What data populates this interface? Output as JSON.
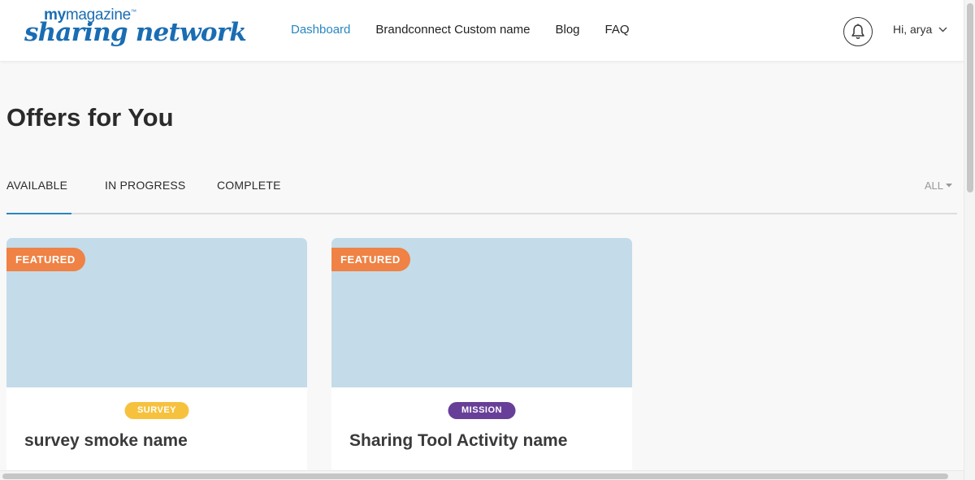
{
  "header": {
    "logo": {
      "top_bold": "my",
      "top_rest": "magazine",
      "top_mark": "™",
      "script": "sharing network"
    },
    "nav": [
      {
        "label": "Dashboard",
        "active": true
      },
      {
        "label": "Brandconnect Custom name",
        "active": false
      },
      {
        "label": "Blog",
        "active": false
      },
      {
        "label": "FAQ",
        "active": false
      }
    ],
    "notification_icon": "bell-icon",
    "user_greeting": "Hi, arya",
    "user_menu_icon": "chevron-down-icon"
  },
  "page": {
    "title": "Offers for You"
  },
  "tabs": {
    "items": [
      {
        "label": "AVAILABLE",
        "active": true
      },
      {
        "label": "IN PROGRESS",
        "active": false
      },
      {
        "label": "COMPLETE",
        "active": false
      }
    ],
    "filter": {
      "label": "ALL",
      "icon": "caret-down-icon"
    }
  },
  "offers": [
    {
      "badge": "FEATURED",
      "type": "SURVEY",
      "type_color": "#f6c23e",
      "title": "survey smoke name"
    },
    {
      "badge": "FEATURED",
      "type": "MISSION",
      "type_color": "#683f98",
      "title": "Sharing Tool Activity name"
    }
  ],
  "colors": {
    "accent": "#2a86c0",
    "brand": "#1a6db3",
    "featured": "#ef8244",
    "card_image": "#c4dbe9",
    "background": "#f8f8f8"
  }
}
